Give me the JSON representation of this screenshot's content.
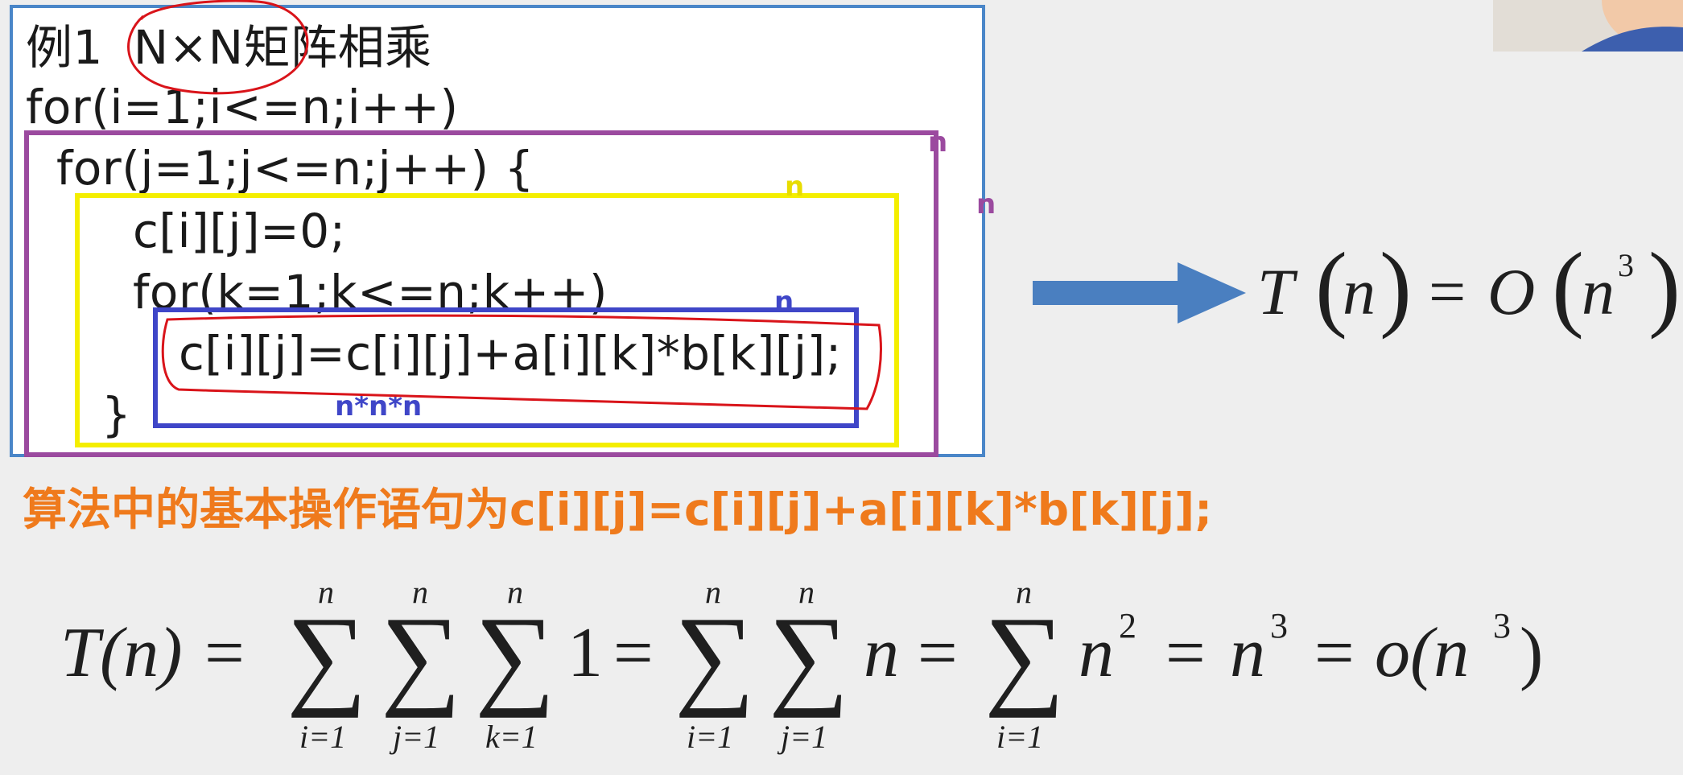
{
  "code": {
    "title": "例1  N×N矩阵相乘",
    "lines": [
      "for(i=1;i<=n;i++)",
      "for(j=1;j<=n;j++) {",
      "c[i][j]=0;",
      "for(k=1;k<=n;k++)",
      "c[i][j]=c[i][j]+a[i][k]*b[k][j];",
      "}"
    ]
  },
  "annotations": {
    "purple_n": "n",
    "purple_n2": "n",
    "yellow_n": "n",
    "blue_n": "n",
    "blue_nnn": "n*n*n"
  },
  "result": {
    "lhs": "T",
    "arg": "n",
    "eq": "=",
    "big_o": "O",
    "base": "n",
    "exp": "3"
  },
  "basic_operation": "算法中的基本操作语句为c[i][j]=c[i][j]+a[i][k]*b[k][j];",
  "formula": {
    "lhs": "T(n) =",
    "sum_upper": "n",
    "sum_i": "i=1",
    "sum_j": "j=1",
    "sum_k": "k=1",
    "one": "1",
    "eq": "=",
    "n": "n",
    "n2_base": "n",
    "n2_exp": "2",
    "n3_base": "n",
    "n3_exp": "3",
    "o_open": "o(n",
    "o_exp": "3",
    "o_close": ")",
    "sigma": "∑"
  },
  "colors": {
    "frame": "#4a86c8",
    "purple": "#9b4a9f",
    "yellow": "#f4ee00",
    "blue": "#3f46c8",
    "red_ink": "#d9141a",
    "orange": "#ef7a1c",
    "arrow": "#4a7fc0"
  }
}
